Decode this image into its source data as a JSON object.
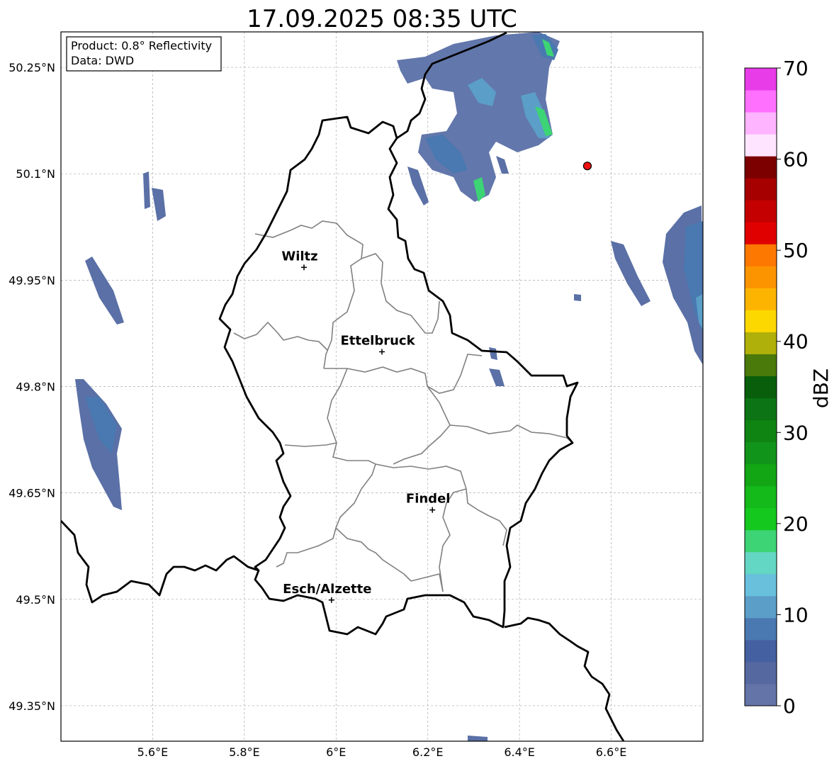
{
  "title": "17.09.2025 08:35 UTC",
  "info": {
    "product": "Product: 0.8° Reflectivity",
    "data": "Data: DWD"
  },
  "map_extent": {
    "lon": [
      5.4,
      6.8
    ],
    "lat": [
      49.3,
      50.3
    ]
  },
  "lon_ticks": [
    {
      "value": 5.6,
      "label": "5.6°E"
    },
    {
      "value": 5.8,
      "label": "5.8°E"
    },
    {
      "value": 6.0,
      "label": "6°E"
    },
    {
      "value": 6.2,
      "label": "6.2°E"
    },
    {
      "value": 6.4,
      "label": "6.4°E"
    },
    {
      "value": 6.6,
      "label": "6.6°E"
    }
  ],
  "lat_ticks": [
    {
      "value": 50.25,
      "label": "50.25°N"
    },
    {
      "value": 50.1,
      "label": "50.1°N"
    },
    {
      "value": 49.95,
      "label": "49.95°N"
    },
    {
      "value": 49.8,
      "label": "49.8°N"
    },
    {
      "value": 49.65,
      "label": "49.65°N"
    },
    {
      "value": 49.5,
      "label": "49.5°N"
    },
    {
      "value": 49.35,
      "label": "49.35°N"
    }
  ],
  "cities": [
    {
      "name": "Wiltz",
      "lon": 5.93,
      "lat": 49.968
    },
    {
      "name": "Ettelbruck",
      "lon": 6.1,
      "lat": 49.849
    },
    {
      "name": "Findel",
      "lon": 6.21,
      "lat": 49.626
    },
    {
      "name": "Esch/Alzette",
      "lon": 5.99,
      "lat": 49.499
    }
  ],
  "radar_site": {
    "lon": 6.548,
    "lat": 50.111,
    "color": "#ee1111"
  },
  "colorbar": {
    "label": "dBZ",
    "min": 0,
    "max": 70,
    "ticks": [
      0,
      10,
      20,
      30,
      40,
      50,
      60,
      70
    ],
    "colors": [
      "#6474a8",
      "#5568a0",
      "#4560a0",
      "#4a78b0",
      "#5b9ec8",
      "#68c0dc",
      "#64d6c4",
      "#3cd474",
      "#14c81e",
      "#14b91a",
      "#12a614",
      "#11941a",
      "#0f8412",
      "#0c7414",
      "#085e0a",
      "#4a7a0a",
      "#b0b00a",
      "#fcd800",
      "#fcb400",
      "#fc9400",
      "#fc7800",
      "#e10000",
      "#c40000",
      "#a60000",
      "#7c0000",
      "#ffe4ff",
      "#ffb4ff",
      "#ff70ff",
      "#e83ce8"
    ]
  }
}
